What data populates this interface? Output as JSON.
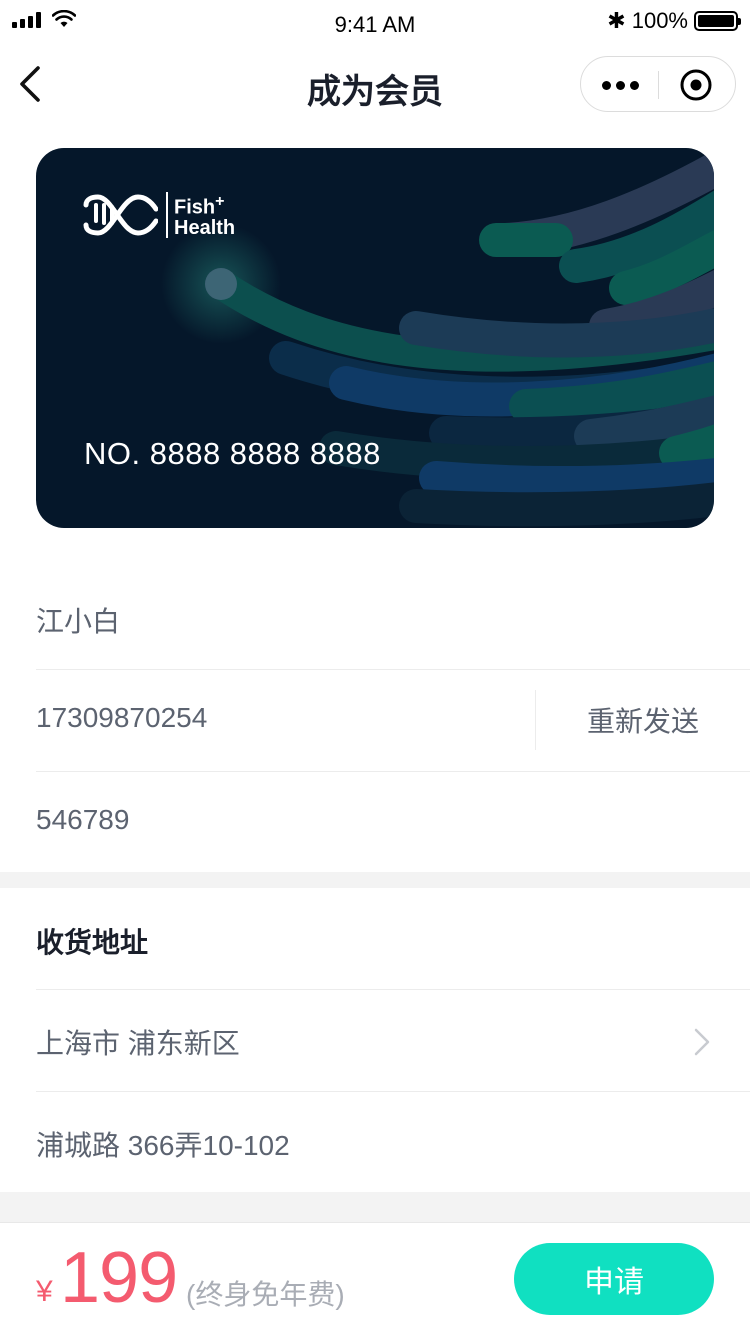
{
  "status_bar": {
    "time": "9:41 AM",
    "battery": "100%"
  },
  "nav": {
    "title": "成为会员",
    "back_icon": "chevron-left-icon",
    "more_icon": "more-dots-icon",
    "close_icon": "target-circle-icon"
  },
  "card": {
    "logo_line1": "Fish",
    "logo_line2": "Health",
    "logo_plus": "+",
    "number": "NO. 8888 8888 8888",
    "colors": {
      "background": "#05172a",
      "wave_green": "#0b5b52",
      "wave_blue": "#0f3a66",
      "wave_slate": "#2a3a55"
    }
  },
  "form": {
    "name": "江小白",
    "phone": "17309870254",
    "resend_label": "重新发送",
    "code": "546789"
  },
  "address": {
    "section_title": "收货地址",
    "region": "上海市 浦东新区",
    "street": "浦城路 366弄10-102"
  },
  "bottom_bar": {
    "currency": "¥",
    "price": "199",
    "price_note": "(终身免年费)",
    "apply_label": "申请",
    "colors": {
      "price": "#f45b6f",
      "button": "#10e0c1"
    }
  }
}
